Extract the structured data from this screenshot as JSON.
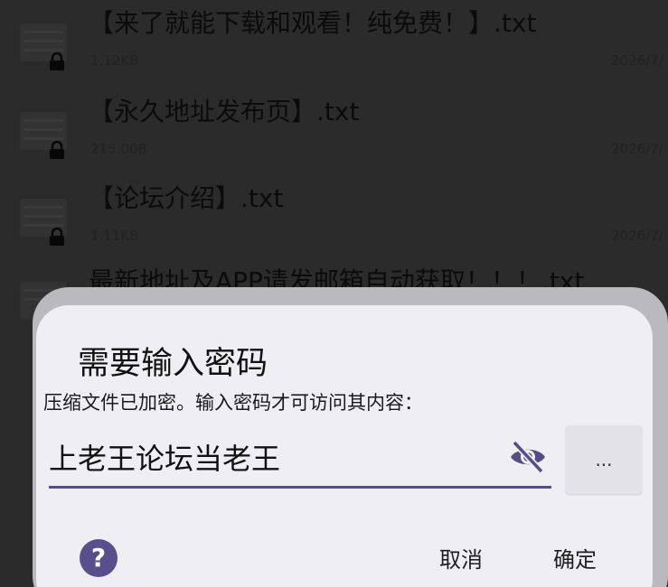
{
  "files": [
    {
      "name": "【来了就能下载和观看！纯免费！】.txt",
      "size": "1.12KB",
      "date": "2026/7/"
    },
    {
      "name": "【永久地址发布页】.txt",
      "size": "215.00B",
      "date": "2026/7/"
    },
    {
      "name": "【论坛介绍】.txt",
      "size": "1.11KB",
      "date": "2026/7/"
    },
    {
      "name": "最新地址及APP请发邮箱自动获取！！！.txt",
      "size": "",
      "date": ""
    }
  ],
  "dialog": {
    "title": "需要输入密码",
    "message": "压缩文件已加密。输入密码才可访问其内容：",
    "password_value": "上老王论坛当老王",
    "more_label": "...",
    "help_label": "?",
    "cancel_label": "取消",
    "ok_label": "确定"
  },
  "icons": {
    "file": "file-icon",
    "lock": "lock-icon",
    "visibility": "eye-off-icon",
    "help": "help-icon"
  },
  "colors": {
    "accent": "#574d86",
    "dialog_bg": "#efeef3",
    "overlay_bg": "#2b2b2b"
  }
}
